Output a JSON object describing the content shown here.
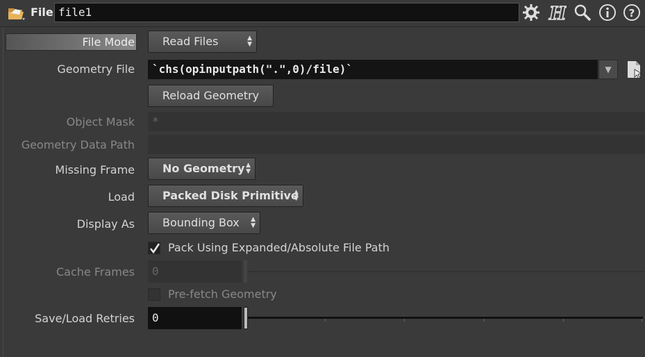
{
  "header": {
    "type_label": "File",
    "node_name": "file1",
    "icons": [
      "folder-icon",
      "gear-icon",
      "houdini-help-icon",
      "search-icon",
      "info-icon",
      "help-icon"
    ]
  },
  "params": {
    "file_mode": {
      "label": "File Mode",
      "value": "Read Files"
    },
    "geometry_file": {
      "label": "Geometry File",
      "value": "`chs(opinputpath(\".\",0)/file)`"
    },
    "reload": {
      "label": "Reload Geometry"
    },
    "object_mask": {
      "label": "Object Mask",
      "placeholder": "*"
    },
    "geometry_data_path": {
      "label": "Geometry Data Path"
    },
    "missing_frame": {
      "label": "Missing Frame",
      "value": "No Geometry"
    },
    "load": {
      "label": "Load",
      "value": "Packed Disk Primitive"
    },
    "display_as": {
      "label": "Display As",
      "value": "Bounding Box"
    },
    "pack_expanded": {
      "label": "Pack Using Expanded/Absolute File Path",
      "checked": true
    },
    "cache_frames": {
      "label": "Cache Frames",
      "value": "0"
    },
    "prefetch": {
      "label": "Pre-fetch Geometry",
      "checked": false
    },
    "retries": {
      "label": "Save/Load Retries",
      "value": "0"
    }
  }
}
